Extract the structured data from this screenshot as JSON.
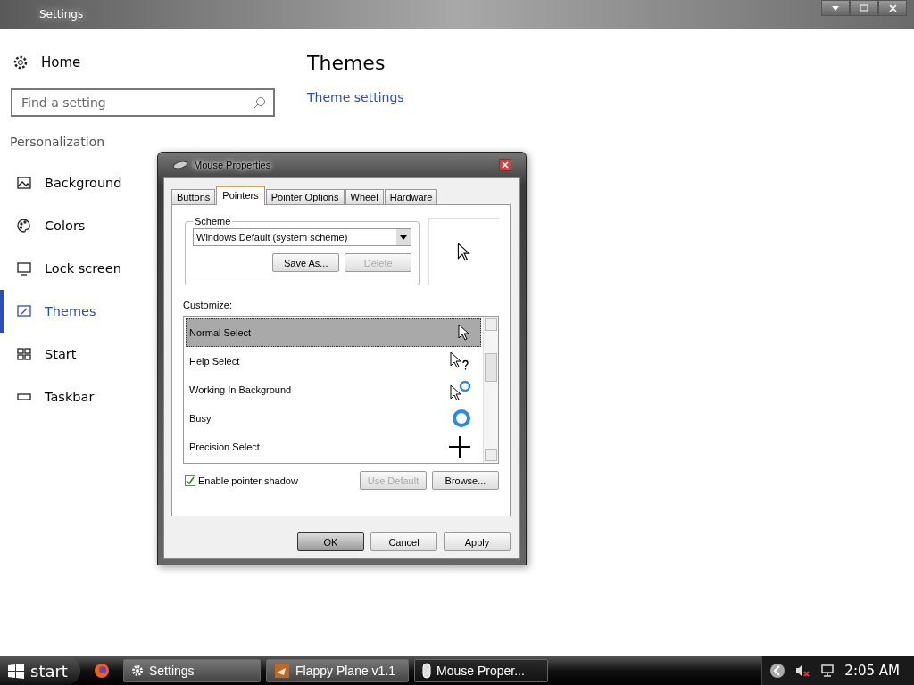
{
  "window": {
    "title": "Settings"
  },
  "sidebar": {
    "home": "Home",
    "search": {
      "placeholder": "Find a setting"
    },
    "section": "Personalization",
    "items": [
      {
        "label": "Background",
        "kind": "picture",
        "selected": false
      },
      {
        "label": "Colors",
        "kind": "palette",
        "selected": false
      },
      {
        "label": "Lock screen",
        "kind": "screen",
        "selected": false
      },
      {
        "label": "Themes",
        "kind": "brush",
        "selected": true
      },
      {
        "label": "Start",
        "kind": "grid",
        "selected": false
      },
      {
        "label": "Taskbar",
        "kind": "bar",
        "selected": false
      }
    ]
  },
  "main": {
    "heading": "Themes",
    "link": "Theme settings"
  },
  "dialog": {
    "title": "Mouse Properties",
    "tabs": [
      {
        "label": "Buttons",
        "selected": false
      },
      {
        "label": "Pointers",
        "selected": true
      },
      {
        "label": "Pointer Options",
        "selected": false
      },
      {
        "label": "Wheel",
        "selected": false
      },
      {
        "label": "Hardware",
        "selected": false
      }
    ],
    "scheme": {
      "label": "Scheme",
      "value": "Windows Default (system scheme)",
      "buttons": [
        {
          "label": "Save As...",
          "disabled": false
        },
        {
          "label": "Delete",
          "disabled": true
        }
      ]
    },
    "customize": {
      "label": "Customize:",
      "rows": [
        {
          "label": "Normal Select",
          "kind": "arrow",
          "selected": true
        },
        {
          "label": "Help Select",
          "kind": "help",
          "selected": false
        },
        {
          "label": "Working In Background",
          "kind": "working",
          "selected": false
        },
        {
          "label": "Busy",
          "kind": "busy",
          "selected": false
        },
        {
          "label": "Precision Select",
          "kind": "cross",
          "selected": false
        }
      ]
    },
    "shadow": {
      "label": "Enable pointer shadow",
      "checked": true
    },
    "row_buttons": [
      {
        "label": "Use Default",
        "disabled": true
      },
      {
        "label": "Browse...",
        "disabled": false
      }
    ],
    "footer_buttons": [
      {
        "label": "OK",
        "selected": true
      },
      {
        "label": "Cancel",
        "selected": false
      },
      {
        "label": "Apply",
        "selected": false
      }
    ]
  },
  "taskbar": {
    "start": "start",
    "tasks": [
      {
        "label": "Settings",
        "kind": "gear",
        "selected": false
      },
      {
        "label": "Flappy Plane v1.1",
        "kind": "game",
        "selected": false
      },
      {
        "label": "Mouse Proper...",
        "kind": "mouse",
        "selected": true
      }
    ],
    "clock": "2:05 AM"
  }
}
